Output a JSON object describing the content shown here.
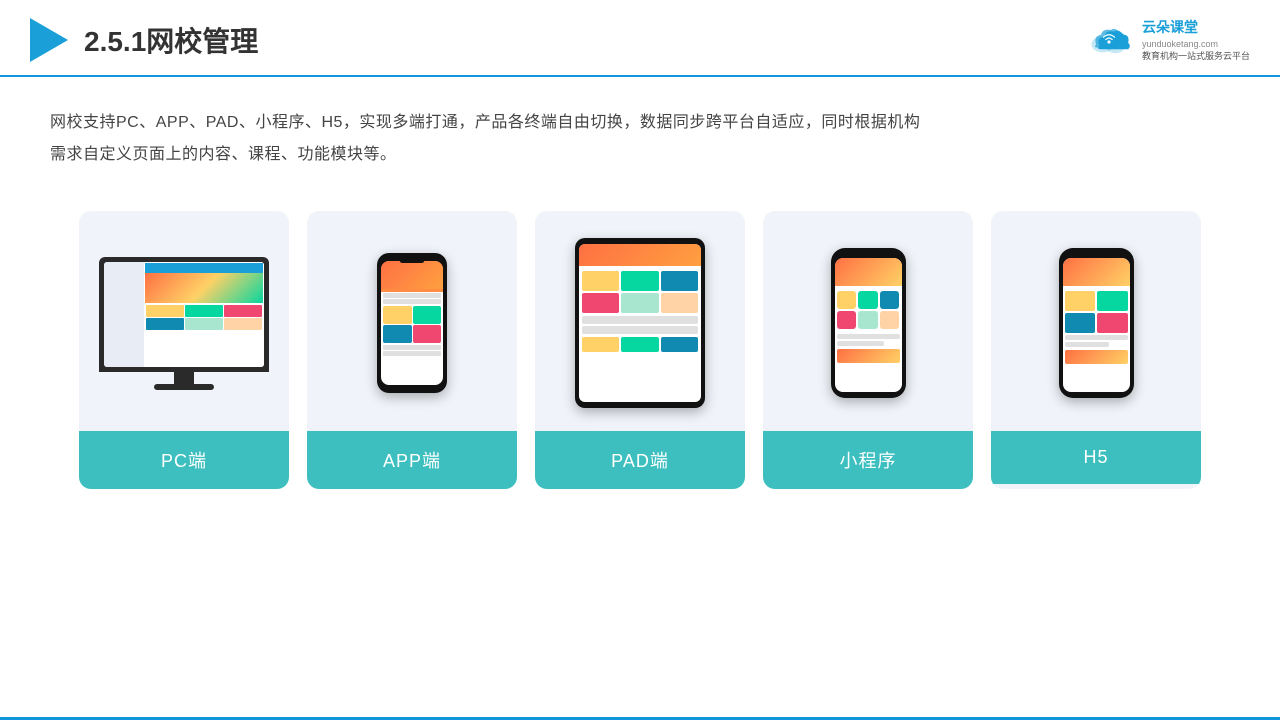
{
  "header": {
    "title": "2.5.1网校管理",
    "brand": {
      "name": "云朵课堂",
      "url": "yunduoketang.com",
      "slogan": "教育机构一站式服务云平台"
    }
  },
  "description": {
    "text_line1": "网校支持PC、APP、PAD、小程序、H5，实现多端打通，产品各终端自由切换，数据同步跨平台自适应，同时根据机构",
    "text_line2": "需求自定义页面上的内容、课程、功能模块等。"
  },
  "cards": [
    {
      "id": "pc",
      "label": "PC端"
    },
    {
      "id": "app",
      "label": "APP端"
    },
    {
      "id": "pad",
      "label": "PAD端"
    },
    {
      "id": "miniprogram",
      "label": "小程序"
    },
    {
      "id": "h5",
      "label": "H5"
    }
  ],
  "colors": {
    "accent": "#1a9fd9",
    "card_label_bg": "#3dbfbf",
    "divider": "#1296db"
  }
}
